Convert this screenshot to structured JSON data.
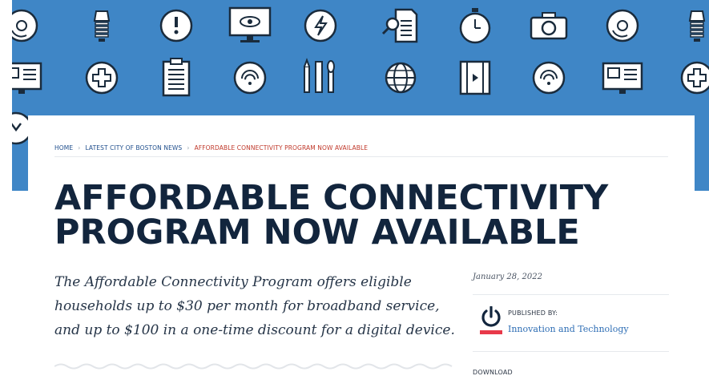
{
  "hero": {
    "background_color": "#3f86c6",
    "icons": [
      "disc-icon",
      "lightbulb-icon",
      "alert-icon",
      "monitor-eye-icon",
      "lightning-icon",
      "document-search-icon",
      "stopwatch-icon",
      "camera-icon",
      "disc-icon",
      "lightbulb-icon",
      "id-card-icon",
      "plus-circle-icon",
      "clipboard-icon",
      "wifi-icon",
      "pencil-ruler-icon",
      "globe-icon",
      "film-icon",
      "wifi-icon",
      "id-card-icon",
      "plus-circle-icon",
      "chevron-circle-icon"
    ]
  },
  "breadcrumb": {
    "items": [
      "HOME",
      "LATEST CITY OF BOSTON NEWS",
      "AFFORDABLE CONNECTIVITY PROGRAM NOW AVAILABLE"
    ],
    "separator": "›"
  },
  "article": {
    "title_line1": "AFFORDABLE CONNECTIVITY",
    "title_line2": "PROGRAM NOW AVAILABLE",
    "intro_line1": "The Affordable Connectivity Program offers eligible",
    "intro_line2": "households up to $30 per month for broadband service,",
    "intro_line3": "and up to $100 in a one-time discount for a digital device."
  },
  "sidebar": {
    "date": "January 28, 2022",
    "published_by_label": "PUBLISHED BY:",
    "department": "Innovation and Technology",
    "download_label": "DOWNLOAD"
  },
  "colors": {
    "title": "#12253d",
    "breadcrumb_link": "#1f4e8c",
    "breadcrumb_current": "#c0392b",
    "dept_link": "#2d6db4",
    "power_icon_red": "#e8394a"
  }
}
